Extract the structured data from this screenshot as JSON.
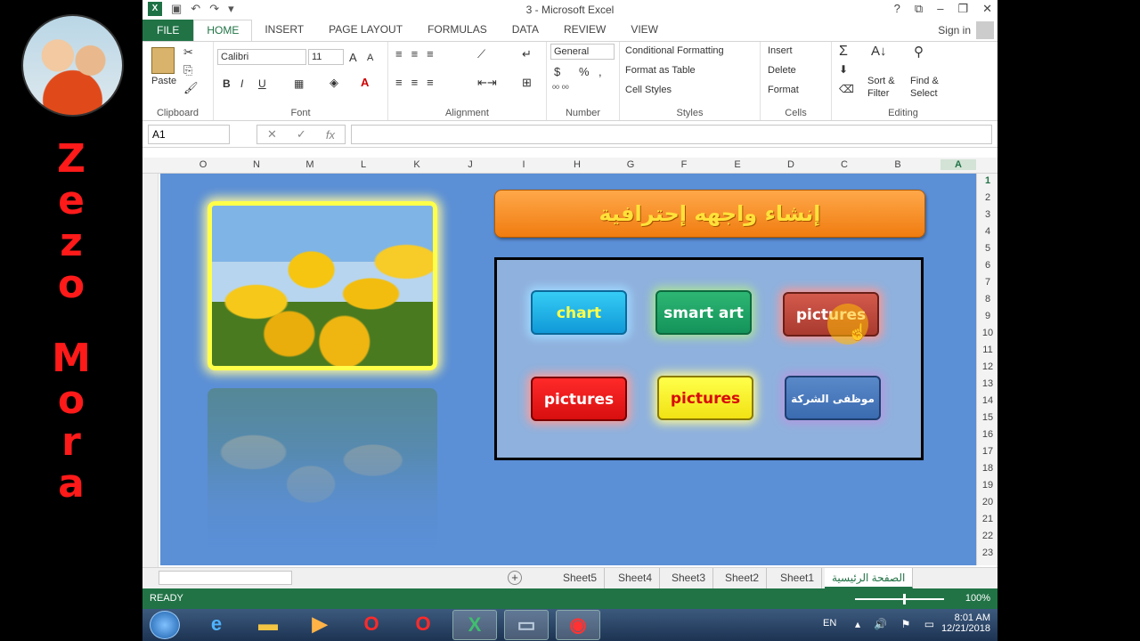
{
  "channel": {
    "letters_top": [
      "Z",
      "e",
      "z",
      "o"
    ],
    "letters_bottom": [
      "M",
      "o",
      "r",
      "a"
    ]
  },
  "window": {
    "title": "3 - Microsoft Excel",
    "help": "?",
    "sign_in": "Sign in"
  },
  "tabs": [
    "FILE",
    "HOME",
    "INSERT",
    "PAGE LAYOUT",
    "FORMULAS",
    "DATA",
    "REVIEW",
    "VIEW"
  ],
  "ribbon": {
    "clipboard": {
      "paste": "Paste",
      "label": "Clipboard"
    },
    "font": {
      "name": "Calibri",
      "size": "11",
      "bold": "B",
      "italic": "I",
      "underline": "U",
      "label": "Font"
    },
    "alignment": {
      "label": "Alignment"
    },
    "number": {
      "format": "General",
      "currency": "$",
      "percent": "%",
      "comma": ",",
      "label": "Number"
    },
    "styles": {
      "conditional": "Conditional Formatting",
      "table": "Format as Table",
      "cell": "Cell Styles",
      "label": "Styles"
    },
    "cells": {
      "insert": "Insert",
      "delete": "Delete",
      "format": "Format",
      "label": "Cells"
    },
    "editing": {
      "sort": "Sort &",
      "filter": "Filter",
      "find": "Find &",
      "select": "Select",
      "label": "Editing"
    }
  },
  "formula_bar": {
    "name_box": "A1",
    "fx": "fx",
    "cancel": "✕",
    "enter": "✓",
    "value": ""
  },
  "columns": [
    "O",
    "N",
    "M",
    "L",
    "K",
    "J",
    "I",
    "H",
    "G",
    "F",
    "E",
    "D",
    "C",
    "B",
    "A"
  ],
  "rows": [
    "1",
    "2",
    "3",
    "4",
    "5",
    "6",
    "7",
    "8",
    "9",
    "10",
    "11",
    "12",
    "13",
    "14",
    "15",
    "16",
    "17",
    "18",
    "19",
    "20",
    "21",
    "22",
    "23"
  ],
  "sheet": {
    "banner": "إنشاء واجهه إحترافية",
    "buttons": {
      "chart": "chart",
      "smart_art": "smart art",
      "pictures_1": "pictures",
      "pictures_2": "pictures",
      "pictures_3": "pictures",
      "employees": "موظفى الشركة"
    }
  },
  "sheet_tabs": [
    "Sheet5",
    "Sheet4",
    "Sheet3",
    "Sheet2",
    "Sheet1",
    "الصفحة الرئيسية"
  ],
  "status": {
    "ready": "READY",
    "zoom": "100%"
  },
  "taskbar": {
    "lang": "EN",
    "time": "8:01 AM",
    "date": "12/21/2018"
  }
}
